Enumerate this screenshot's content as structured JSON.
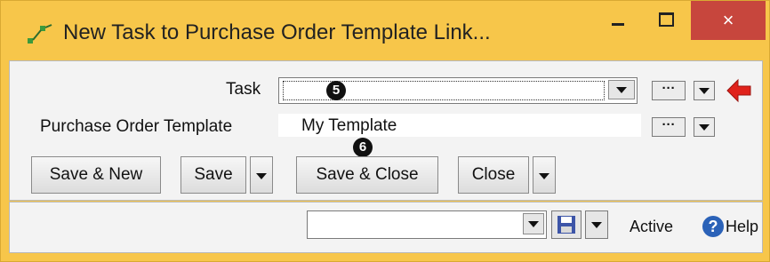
{
  "window": {
    "title": "New Task to Purchase Order Template Link...",
    "close_glyph": "×",
    "accent_color": "#f7c64a",
    "close_color": "#c7463d"
  },
  "form": {
    "task_label": "Task",
    "task_value": "",
    "po_template_label": "Purchase Order Template",
    "po_template_value": "My Template",
    "ellipsis_label": "···"
  },
  "callouts": {
    "five": "5",
    "six": "6"
  },
  "buttons": {
    "save_new": "Save & New",
    "save": "Save",
    "save_close": "Save & Close",
    "close": "Close"
  },
  "footer": {
    "status_value": "",
    "active_label": "Active",
    "help_label": "Help",
    "help_glyph": "?"
  },
  "icons": [
    "app-link-icon",
    "minimize-icon",
    "maximize-icon",
    "close-icon",
    "dropdown-arrow-icon",
    "red-arrow-icon",
    "floppy-save-icon",
    "help-icon"
  ]
}
